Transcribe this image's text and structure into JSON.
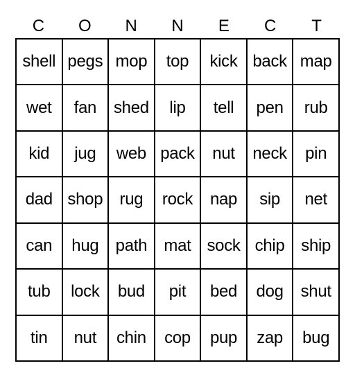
{
  "card": {
    "header": [
      "C",
      "O",
      "N",
      "N",
      "E",
      "C",
      "T"
    ],
    "rows": [
      [
        "shell",
        "pegs",
        "mop",
        "top",
        "kick",
        "back",
        "map"
      ],
      [
        "wet",
        "fan",
        "shed",
        "lip",
        "tell",
        "pen",
        "rub"
      ],
      [
        "kid",
        "jug",
        "web",
        "pack",
        "nut",
        "neck",
        "pin"
      ],
      [
        "dad",
        "shop",
        "rug",
        "rock",
        "nap",
        "sip",
        "net"
      ],
      [
        "can",
        "hug",
        "path",
        "mat",
        "sock",
        "chip",
        "ship"
      ],
      [
        "tub",
        "lock",
        "bud",
        "pit",
        "bed",
        "dog",
        "shut"
      ],
      [
        "tin",
        "nut",
        "chin",
        "cop",
        "pup",
        "zap",
        "bug"
      ]
    ]
  }
}
